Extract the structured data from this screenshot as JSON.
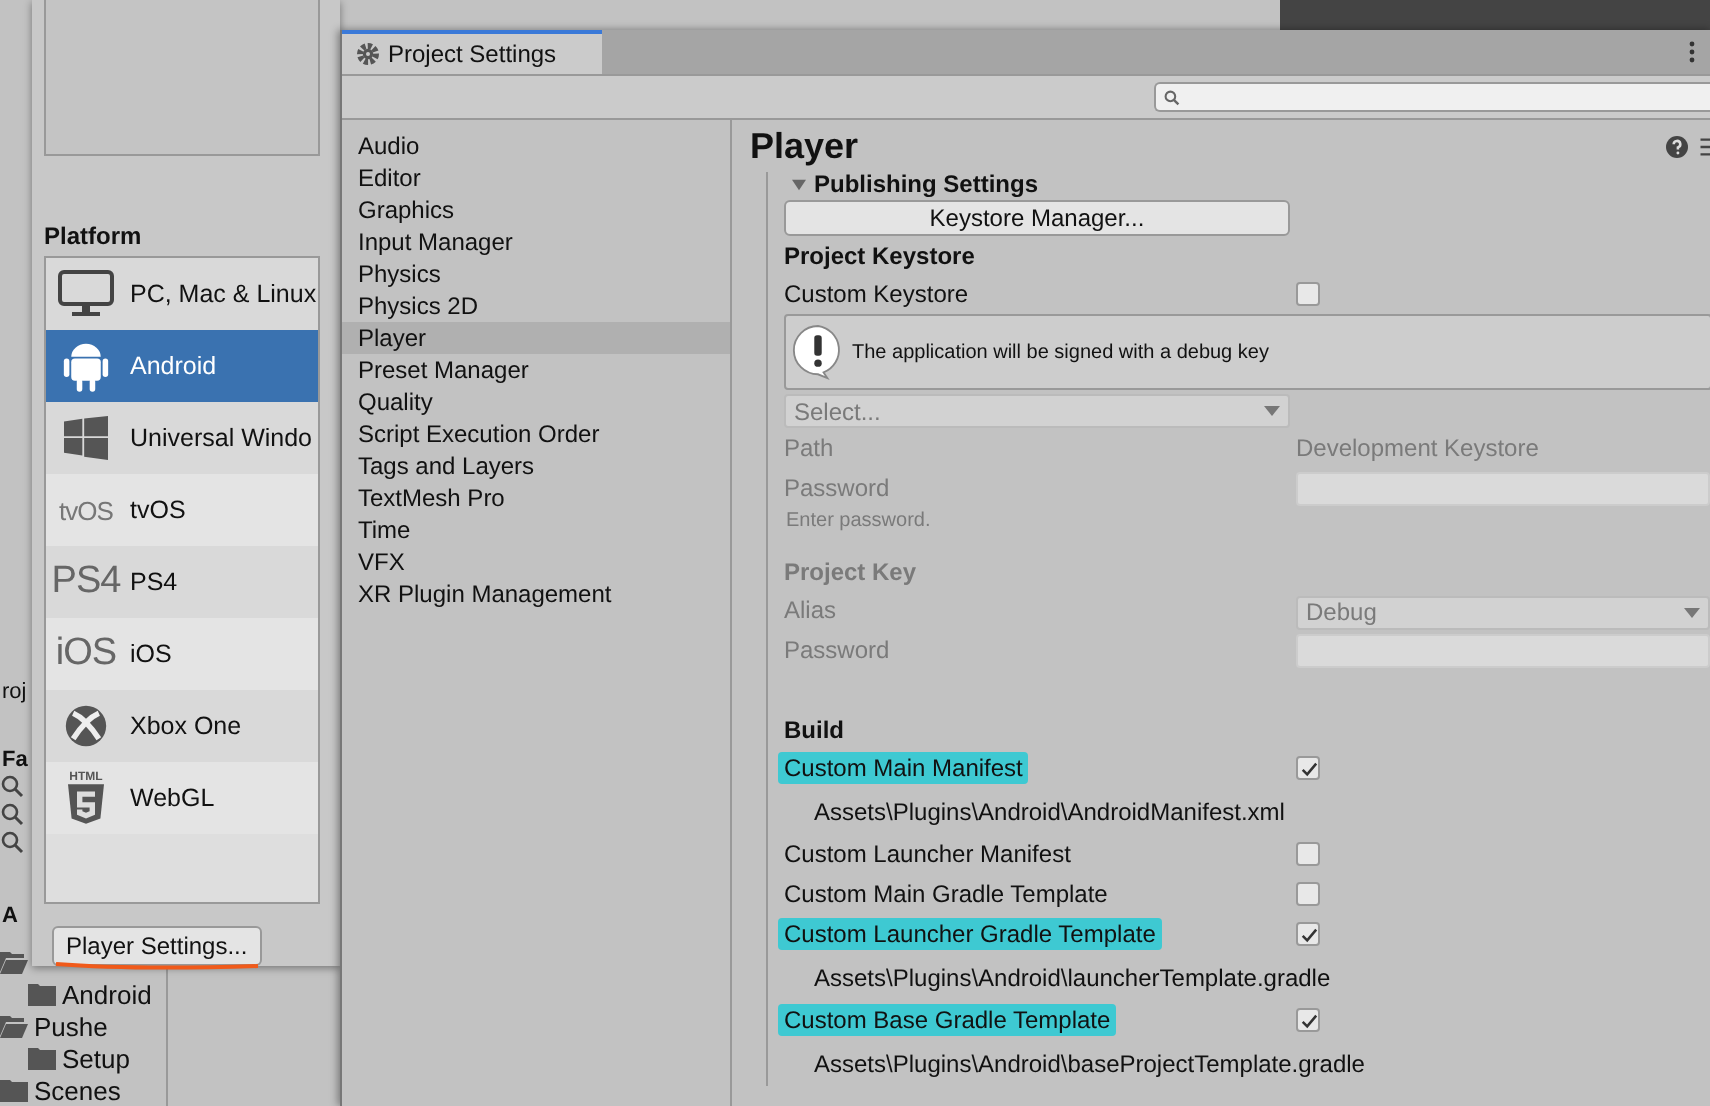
{
  "project_panel": {
    "tab_label": "roj",
    "section_label": "Fa",
    "assets_label": "A",
    "tree": [
      {
        "expanded": true,
        "children": [
          {
            "label": "Android"
          }
        ]
      },
      {
        "label": "Pushe",
        "expanded": true,
        "children": [
          {
            "label": "Setup"
          }
        ]
      },
      {
        "label": "Scenes",
        "expanded": false
      }
    ]
  },
  "build_settings": {
    "platform_heading": "Platform",
    "platforms": [
      {
        "kind": "monitor",
        "label": "PC, Mac & Linux",
        "selected": false
      },
      {
        "kind": "android",
        "label": "Android",
        "selected": true
      },
      {
        "kind": "windows",
        "label": "Universal Windo",
        "selected": false
      },
      {
        "kind": "text",
        "icon_text": "tvOS",
        "label": "tvOS",
        "selected": false
      },
      {
        "kind": "text",
        "icon_text": "PS4",
        "label": "PS4",
        "selected": false
      },
      {
        "kind": "text",
        "icon_text": "iOS",
        "label": "iOS",
        "selected": false
      },
      {
        "kind": "xbox",
        "label": "Xbox One",
        "selected": false
      },
      {
        "kind": "html5",
        "icon_text": "HTML",
        "label": "WebGL",
        "selected": false
      }
    ],
    "player_settings_button": "Player Settings...",
    "button_underlined": true
  },
  "project_settings": {
    "tab": "Project Settings",
    "sidebar": {
      "items": [
        {
          "label": "Audio",
          "selected": false
        },
        {
          "label": "Editor",
          "selected": false
        },
        {
          "label": "Graphics",
          "selected": false
        },
        {
          "label": "Input Manager",
          "selected": false
        },
        {
          "label": "Physics",
          "selected": false
        },
        {
          "label": "Physics 2D",
          "selected": false
        },
        {
          "label": "Player",
          "selected": true
        },
        {
          "label": "Preset Manager",
          "selected": false
        },
        {
          "label": "Quality",
          "selected": false
        },
        {
          "label": "Script Execution Order",
          "selected": false
        },
        {
          "label": "Tags and Layers",
          "selected": false
        },
        {
          "label": "TextMesh Pro",
          "selected": false
        },
        {
          "label": "Time",
          "selected": false
        },
        {
          "label": "VFX",
          "selected": false
        },
        {
          "label": "XR Plugin Management",
          "selected": false
        }
      ]
    },
    "page_title": "Player",
    "publishing": {
      "title": "Publishing Settings",
      "expanded": true,
      "keystore_manager_button": "Keystore Manager...",
      "project_keystore": {
        "heading": "Project Keystore",
        "custom_keystore": {
          "label": "Custom Keystore",
          "checked": false
        },
        "help_message": "The application will be signed with a debug key",
        "keystore_dropdown": {
          "value": "Select...",
          "disabled": true
        },
        "fields_disabled": true,
        "path": {
          "label": "Path",
          "value": "Development Keystore"
        },
        "password": {
          "label": "Password",
          "hint": "Enter password."
        }
      },
      "project_key": {
        "heading": "Project Key",
        "disabled": true,
        "alias": {
          "label": "Alias",
          "value": "Debug"
        },
        "password": {
          "label": "Password"
        }
      },
      "build": {
        "heading": "Build",
        "items": [
          {
            "kind": "toggle",
            "label": "Custom Main Manifest",
            "checked": true,
            "highlighted": true
          },
          {
            "kind": "path",
            "text": "Assets\\Plugins\\Android\\AndroidManifest.xml"
          },
          {
            "kind": "toggle",
            "label": "Custom Launcher Manifest",
            "checked": false,
            "highlighted": false
          },
          {
            "kind": "toggle",
            "label": "Custom Main Gradle Template",
            "checked": false,
            "highlighted": false
          },
          {
            "kind": "toggle",
            "label": "Custom Launcher Gradle Template",
            "checked": true,
            "highlighted": true
          },
          {
            "kind": "path",
            "text": "Assets\\Plugins\\Android\\launcherTemplate.gradle"
          },
          {
            "kind": "toggle",
            "label": "Custom Base Gradle Template",
            "checked": true,
            "highlighted": true
          },
          {
            "kind": "path",
            "text": "Assets\\Plugins\\Android\\baseProjectTemplate.gradle"
          }
        ]
      }
    }
  }
}
